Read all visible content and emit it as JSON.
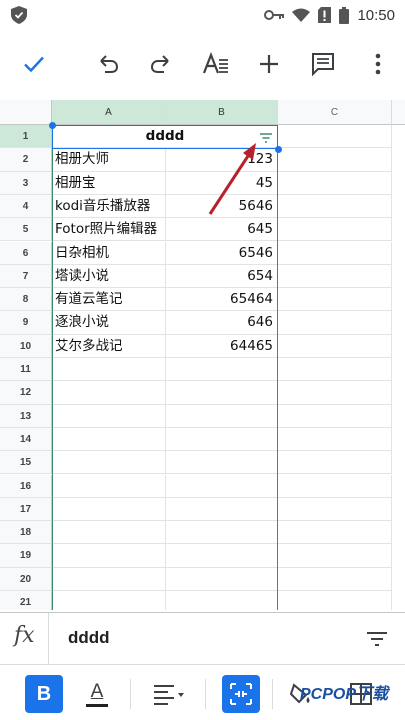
{
  "status_bar": {
    "time": "10:50"
  },
  "formula_bar": {
    "fx_label": "fx",
    "value": "dddd"
  },
  "columns": [
    "A",
    "B",
    "C"
  ],
  "rows": [
    {
      "n": "1",
      "a": "dddd",
      "b": ""
    },
    {
      "n": "2",
      "a": "相册大师",
      "b": "123"
    },
    {
      "n": "3",
      "a": "相册宝",
      "b": "45"
    },
    {
      "n": "4",
      "a": "kodi音乐播放器",
      "b": "5646"
    },
    {
      "n": "5",
      "a": "Fotor照片编辑器",
      "b": "645"
    },
    {
      "n": "6",
      "a": "日杂相机",
      "b": "6546"
    },
    {
      "n": "7",
      "a": "塔读小说",
      "b": "654"
    },
    {
      "n": "8",
      "a": "有道云笔记",
      "b": "65464"
    },
    {
      "n": "9",
      "a": "逐浪小说",
      "b": "646"
    },
    {
      "n": "10",
      "a": "艾尔多战记",
      "b": "64465"
    },
    {
      "n": "11",
      "a": "",
      "b": ""
    },
    {
      "n": "12",
      "a": "",
      "b": ""
    },
    {
      "n": "13",
      "a": "",
      "b": ""
    },
    {
      "n": "14",
      "a": "",
      "b": ""
    },
    {
      "n": "15",
      "a": "",
      "b": ""
    },
    {
      "n": "16",
      "a": "",
      "b": ""
    },
    {
      "n": "17",
      "a": "",
      "b": ""
    },
    {
      "n": "18",
      "a": "",
      "b": ""
    },
    {
      "n": "19",
      "a": "",
      "b": ""
    },
    {
      "n": "20",
      "a": "",
      "b": ""
    },
    {
      "n": "21",
      "a": "",
      "b": ""
    }
  ],
  "bottom_toolbar": {
    "bold_label": "B",
    "text_color_label": "A"
  },
  "watermark": "PCPOP下载",
  "colors": {
    "accent": "#1a73e8",
    "selection": "#cde8d9",
    "selection_border": "#3b8d6d",
    "arrow": "#b5222b"
  }
}
